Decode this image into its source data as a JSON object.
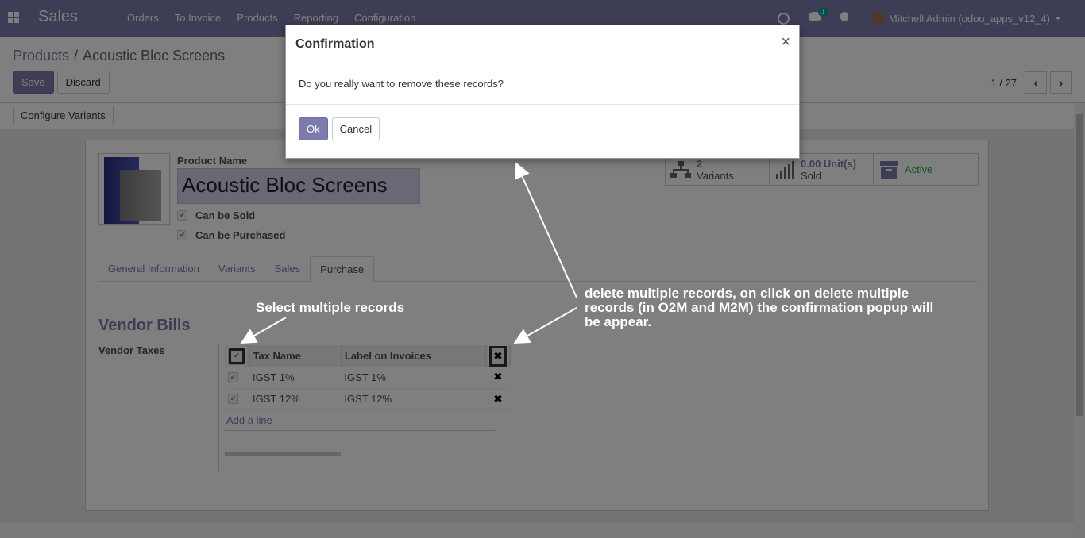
{
  "navbar": {
    "app_name": "Sales",
    "menu": [
      "Orders",
      "To Invoice",
      "Products",
      "Reporting",
      "Configuration"
    ],
    "chat_badge": "1",
    "user": "Mitchell Admin (odoo_apps_v12_4)"
  },
  "breadcrumb": {
    "parent": "Products",
    "separator": "/",
    "current": "Acoustic Bloc Screens"
  },
  "buttons": {
    "save": "Save",
    "discard": "Discard",
    "configure_variants": "Configure Variants"
  },
  "pager": {
    "value": "1 / 27",
    "prev": "‹",
    "next": "›"
  },
  "product": {
    "name_label": "Product Name",
    "name": "Acoustic Bloc Screens",
    "can_be_sold": "Can be Sold",
    "can_be_purchased": "Can be Purchased"
  },
  "smart_buttons": {
    "variants_value": "2",
    "variants_label": "Variants",
    "sold_value": "0.00 Unit(s)",
    "sold_label": "Sold",
    "active_label": "Active"
  },
  "tabs": [
    "General Information",
    "Variants",
    "Sales",
    "Purchase"
  ],
  "active_tab": "Purchase",
  "vendor_bills": {
    "title": "Vendor Bills",
    "taxes_label": "Vendor Taxes",
    "columns": [
      "Tax Name",
      "Label on Invoices"
    ],
    "rows": [
      {
        "name": "IGST 1%",
        "label": "IGST 1%"
      },
      {
        "name": "IGST 12%",
        "label": "IGST 12%"
      }
    ],
    "add_line": "Add a line",
    "delete_glyph": "✖",
    "check_glyph": "✔"
  },
  "modal": {
    "title": "Confirmation",
    "close": "×",
    "message": "Do you really want to remove these records?",
    "ok": "Ok",
    "cancel": "Cancel"
  },
  "annotations": {
    "select_multiple": "Select multiple records",
    "delete_multiple_1": "delete multiple records, on click on delete multiple",
    "delete_multiple_2": "records (in O2M and M2M) the confirmation popup will",
    "delete_multiple_3": "be appear."
  },
  "colors": {
    "primary": "#7c7bad",
    "active": "#28a745",
    "badge": "#00a09d"
  }
}
